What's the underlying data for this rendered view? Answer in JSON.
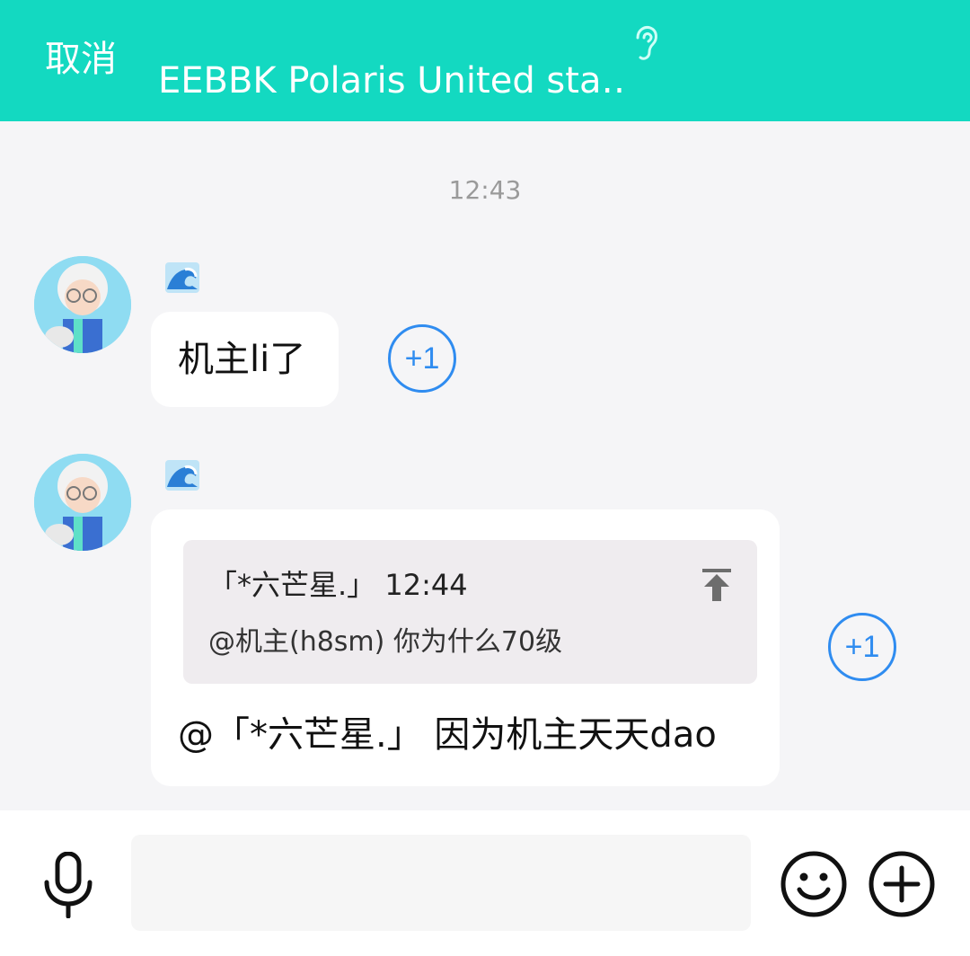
{
  "header": {
    "cancel_label": "取消",
    "title": "EEBBK Polaris United sta…",
    "mode_icon": "ear-icon"
  },
  "chat": {
    "timestamp": "12:43",
    "messages": [
      {
        "sender_badge": "wave-emoji-icon",
        "text": "机主li了",
        "reaction_label": "+1"
      },
      {
        "sender_badge": "wave-emoji-icon",
        "quote": {
          "header": "「*六芒星.」 12:44",
          "body": "@机主(h8sm) 你为什么70级",
          "icon": "pin-to-top-icon"
        },
        "text": "@「*六芒星.」 因为机主天天dao",
        "reaction_label": "+1"
      }
    ]
  },
  "input_bar": {
    "mic_icon": "mic-icon",
    "placeholder": "",
    "emoji_icon": "emoji-icon",
    "plus_icon": "plus-icon"
  },
  "colors": {
    "header_bg": "#13d9c1",
    "accent_blue": "#2f8cf0",
    "chat_bg": "#f5f5f7"
  }
}
